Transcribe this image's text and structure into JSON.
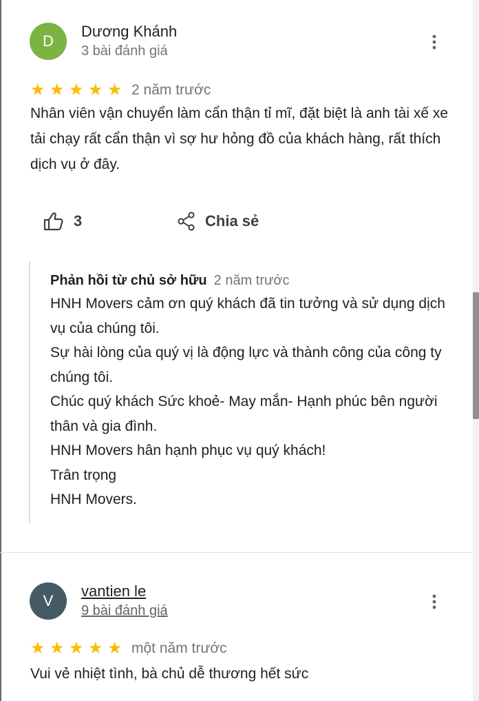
{
  "reviews": [
    {
      "avatar": {
        "letter": "D",
        "color": "#7cb342"
      },
      "author": "Dương Khánh",
      "meta": "3 bài đánh giá",
      "stars": 5,
      "time": "2 năm trước",
      "text": "Nhân viên vận chuyển làm cẩn thận tỉ mĩ, đặt biệt là anh tài xế xe tải chạy rất cẩn thận vì sợ hư hỏng đồ của khách hàng, rất thích dịch vụ ở đây.",
      "likes": "3",
      "share_label": "Chia sẻ",
      "owner_reply": {
        "title": "Phản hồi từ chủ sở hữu",
        "time": "2 năm trước",
        "lines": [
          "HNH Movers cảm ơn quý khách đã tin tưởng và sử dụng dịch vụ của chúng tôi.",
          "Sự hài lòng của quý vị là động lực và thành công của công ty chúng tôi.",
          "Chúc quý khách Sức khoẻ- May mắn- Hạnh phúc bên người thân và gia đình.",
          "HNH Movers hân hạnh phục vụ quý khách!",
          "Trân trọng",
          "HNH Movers."
        ]
      }
    },
    {
      "avatar": {
        "letter": "V",
        "color": "#455a64"
      },
      "author": "vantien le",
      "meta": "9 bài đánh giá",
      "stars": 5,
      "time": "một năm trước",
      "text": "Vui vẻ nhiệt tình, bà chủ dễ thương hết sức"
    }
  ],
  "icons": {
    "star": "star-icon",
    "more": "more-vert-icon",
    "like": "thumb-up-icon",
    "share": "share-icon"
  },
  "colors": {
    "star": "#fbbc04",
    "secondary_text": "#70757a"
  }
}
